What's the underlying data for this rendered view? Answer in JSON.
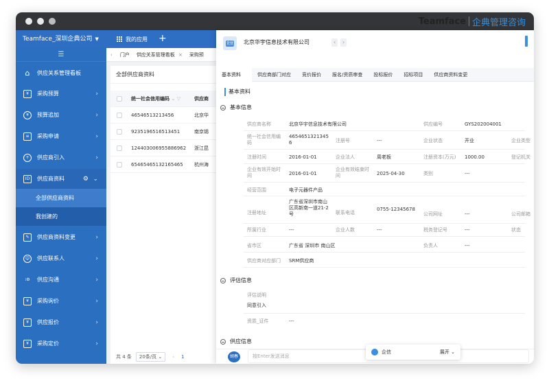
{
  "brand": {
    "en": "Teamface",
    "cn": "企典管理咨询"
  },
  "topbar": {
    "company": "Teamface_深圳企典公司",
    "my_apps": "我的应用",
    "add": "+"
  },
  "sidebar": {
    "collapse_icon": "☰",
    "items": [
      {
        "label": "供应关系管理看板",
        "icon": "home-icon",
        "arrow": ""
      },
      {
        "label": "采购预算",
        "icon": "budget-icon",
        "arrow": "›"
      },
      {
        "label": "预算追加",
        "icon": "budget-add-icon",
        "arrow": "›"
      },
      {
        "label": "采购申请",
        "icon": "request-icon",
        "arrow": "›"
      },
      {
        "label": "供应商引入",
        "icon": "supplier-intro-icon",
        "arrow": "›"
      },
      {
        "label": "供应商资料",
        "icon": "supplier-data-icon",
        "arrow": "⌄"
      },
      {
        "label": "供应商资料变更",
        "icon": "change-icon",
        "arrow": "›"
      },
      {
        "label": "供应联系人",
        "icon": "contact-icon",
        "arrow": "›"
      },
      {
        "label": "供应沟通",
        "icon": "communicate-icon",
        "arrow": "›"
      },
      {
        "label": "采购询价",
        "icon": "inquiry-icon",
        "arrow": "›"
      },
      {
        "label": "供应报价",
        "icon": "quote-icon",
        "arrow": "›"
      },
      {
        "label": "采购定价",
        "icon": "pricing-icon",
        "arrow": "›"
      }
    ],
    "sub_items": [
      "全部供应商资料",
      "我创建的"
    ]
  },
  "tabs": {
    "back": "‹",
    "home": "门户",
    "kanban": "供应关系管理看板",
    "close": "×",
    "more": "采购预"
  },
  "list": {
    "title": "全部供应商资料",
    "headers": [
      "统一社会信用编码",
      "供应商"
    ],
    "rows": [
      [
        "46546513213456",
        "北京华"
      ],
      [
        "9235196516513451",
        "南京锡"
      ],
      [
        "124403006955886962",
        "浙江昆"
      ],
      [
        "65465465132165465",
        "杭州海"
      ]
    ],
    "pager": {
      "total": "共 4 条",
      "page_size": "20条/页",
      "prev": "‹",
      "page": "1"
    }
  },
  "drawer": {
    "logo_text": "企业",
    "title": "北京华宇信息技术有限公司",
    "prev": "‹",
    "next": "›",
    "tabs": [
      "基本资料",
      "供应商部门对应",
      "竞价报价",
      "报名/资质审查",
      "投标报价",
      "招标项目",
      "供应商资料变更"
    ],
    "section_top": "基本资料",
    "sections": {
      "basic": "基本信息",
      "eval": "评估信息",
      "supply": "供应信息"
    },
    "fields": {
      "supplier_name_l": "供应商名称",
      "supplier_name_v": "北京华宇信息技术有限公司",
      "supplier_no_l": "供应编号",
      "supplier_no_v": "GYS202004001",
      "credit_l": "统一社会信用编码",
      "credit_v": "46546513213456",
      "reg_no_l": "注册号",
      "reg_no_v": "---",
      "status_l": "企业状态",
      "status_v": "开业",
      "type_l": "企业类型",
      "reg_time_l": "注册时间",
      "reg_time_v": "2016-01-01",
      "legal_l": "企业法人",
      "legal_v": "周老板",
      "capital_l": "注册资本(万元)",
      "capital_v": "1000.00",
      "authority_l": "登记机关",
      "valid_start_l": "企业有效开始时间",
      "valid_start_v": "2016-01-01",
      "valid_end_l": "企业有效结束时间",
      "valid_end_v": "2025-04-30",
      "category_l": "类别",
      "category_v": "---",
      "scope_l": "经营范围",
      "scope_v": "电子元器件产品",
      "address_l": "注册地址",
      "address_v": "广东省深圳市南山区高新南一道21-2号",
      "phone_l": "联系电话",
      "phone_v": "0755-12345678",
      "site_l": "公司网址",
      "site_v": "---",
      "email_l": "公司邮箱",
      "industry_l": "所属行业",
      "industry_v": "---",
      "staff_l": "企业人数",
      "staff_v": "---",
      "tax_l": "税务登记号",
      "tax_v": "---",
      "state_l": "状态",
      "region_l": "省市区",
      "region_v": "广东省 深圳市 南山区",
      "owner_l": "负责人",
      "owner_v": "---",
      "dept_l": "供应商对应部门",
      "dept_v": "SRM供应商",
      "eval_desc_l": "评估说明",
      "eval_desc_v": "同意引入",
      "cert_l": "资质_证件",
      "cert_v": "---"
    },
    "chat": {
      "avatar": "胡春",
      "placeholder": "按Enter发送消息"
    },
    "qx": {
      "label": "企信",
      "expand": "展开 ⌄"
    }
  }
}
